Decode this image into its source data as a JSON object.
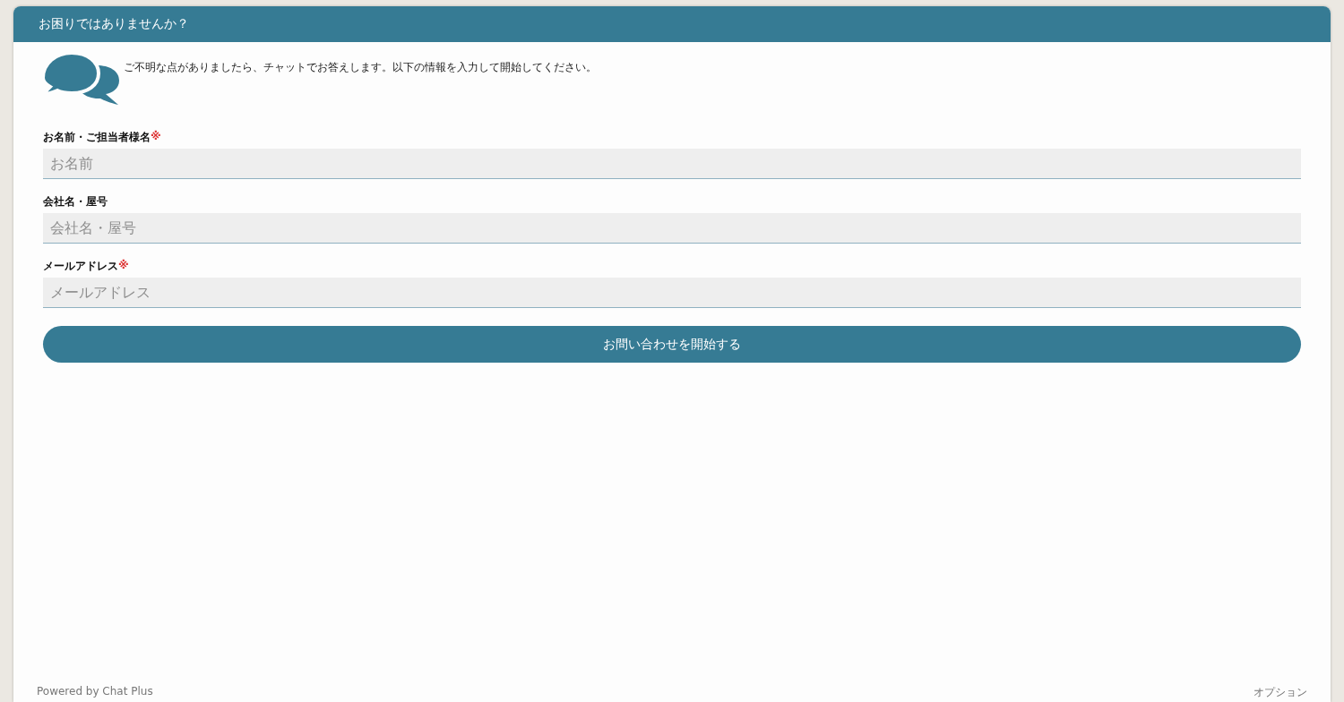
{
  "header": {
    "title": "お困りではありませんか？"
  },
  "intro": {
    "text": "ご不明な点がありましたら、チャットでお答えします。以下の情報を入力して開始してください。"
  },
  "form": {
    "fields": [
      {
        "label": "お名前・ご担当者様名",
        "required_mark": "※",
        "placeholder": "お名前"
      },
      {
        "label": "会社名・屋号",
        "placeholder": "会社名・屋号"
      },
      {
        "label": "メールアドレス",
        "required_mark": "※",
        "placeholder": "メールアドレス"
      }
    ],
    "submit": "お問い合わせを開始する"
  },
  "footer": {
    "powered_by": "Powered by Chat Plus",
    "options": "オプション"
  }
}
